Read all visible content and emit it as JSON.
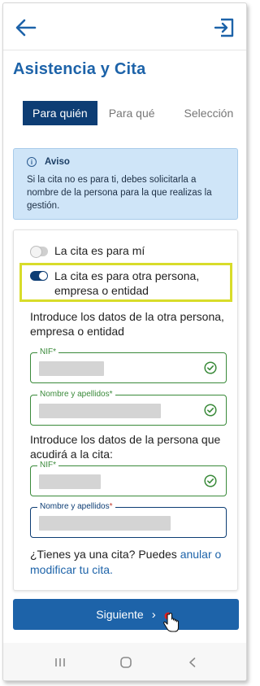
{
  "header": {
    "back_icon": "arrow-left-icon",
    "exit_icon": "logout-icon",
    "accent_color": "#1d63a9"
  },
  "page": {
    "title": "Asistencia y Cita"
  },
  "tabs": [
    {
      "label": "Para quién",
      "active": true
    },
    {
      "label": "Para qué",
      "active": false
    },
    {
      "label": "Selección",
      "active": false
    }
  ],
  "aviso": {
    "title": "Aviso",
    "text": "Si la cita no es para ti, debes solicitarla a nombre de la persona para la que realizas la gestión."
  },
  "options": {
    "self": {
      "label": "La cita es para mí",
      "checked": false
    },
    "other": {
      "label": "La cita es para otra persona, empresa o entidad",
      "checked": true
    }
  },
  "section1": {
    "label": "Introduce los datos de la otra persona, empresa o entidad"
  },
  "section2": {
    "label": "Introduce los datos de la persona que acudirá a la cita:"
  },
  "fields": {
    "nif1": {
      "label": "NIF*"
    },
    "name1": {
      "label": "Nombre y apellidos*"
    },
    "nif2": {
      "label": "NIF*"
    },
    "name2": {
      "label": "Nombre y apellidos",
      "required_mark": "*"
    }
  },
  "footer": {
    "text": "¿Tienes ya una cita? Puedes ",
    "link": "anular o modificar tu cita."
  },
  "next_button": {
    "label": "Siguiente"
  },
  "navbar": {
    "recent_icon": "recent-apps-icon",
    "home_icon": "home-icon",
    "back_icon": "nav-back-icon"
  }
}
